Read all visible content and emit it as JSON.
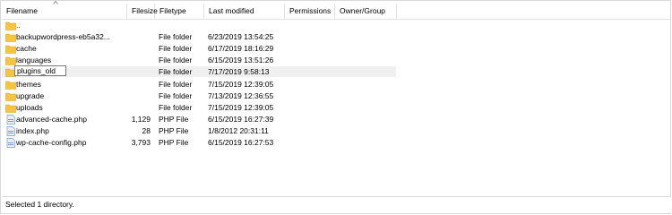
{
  "columns": {
    "filename": "Filename",
    "filesize": "Filesize",
    "filetype": "Filetype",
    "last_modified": "Last modified",
    "permissions": "Permissions",
    "owner_group": "Owner/Group"
  },
  "rows": [
    {
      "name": "..",
      "size": "",
      "type": "",
      "modified": "",
      "icon": "folder-icon"
    },
    {
      "name": "backupwordpress-eb5a32...",
      "size": "",
      "type": "File folder",
      "modified": "6/23/2019 13:54:25",
      "icon": "folder-icon"
    },
    {
      "name": "cache",
      "size": "",
      "type": "File folder",
      "modified": "6/17/2019 18:16:29",
      "icon": "folder-icon"
    },
    {
      "name": "languages",
      "size": "",
      "type": "File folder",
      "modified": "6/15/2019 13:51:26",
      "icon": "folder-icon"
    },
    {
      "name": "plugins_old",
      "size": "",
      "type": "File folder",
      "modified": "7/17/2019 9:58:13",
      "icon": "folder-icon"
    },
    {
      "name": "themes",
      "size": "",
      "type": "File folder",
      "modified": "7/15/2019 12:39:05",
      "icon": "folder-icon"
    },
    {
      "name": "upgrade",
      "size": "",
      "type": "File folder",
      "modified": "7/13/2019 12:36:55",
      "icon": "folder-icon"
    },
    {
      "name": "uploads",
      "size": "",
      "type": "File folder",
      "modified": "7/15/2019 12:39:05",
      "icon": "folder-icon"
    },
    {
      "name": "advanced-cache.php",
      "size": "1,129",
      "type": "PHP File",
      "modified": "6/15/2019 16:27:39",
      "icon": "php-file-icon"
    },
    {
      "name": "index.php",
      "size": "28",
      "type": "PHP File",
      "modified": "1/8/2012 20:31:11",
      "icon": "php-file-icon"
    },
    {
      "name": "wp-cache-config.php",
      "size": "3,793",
      "type": "PHP File",
      "modified": "6/15/2019 16:27:53",
      "icon": "php-file-icon"
    }
  ],
  "selected_row_index": 4,
  "rename_value": "plugins_old",
  "status": "Selected 1 directory.",
  "colors": {
    "folder": "#f5c542",
    "selected_row": "#f0f0f0",
    "file": "#7a9cc6"
  }
}
